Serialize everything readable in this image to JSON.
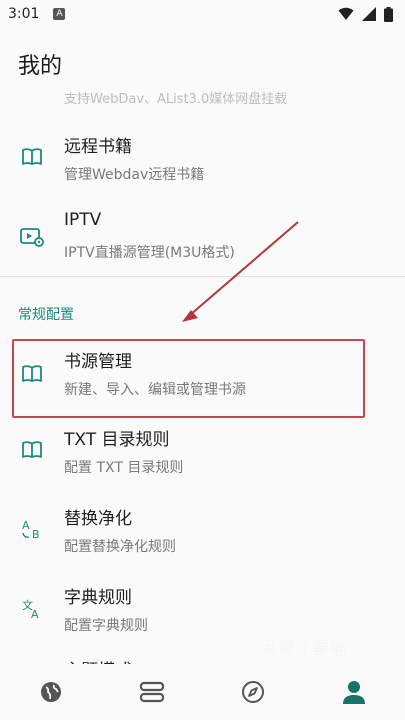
{
  "status_bar": {
    "time": "3:01",
    "app_badge": "A"
  },
  "header": {
    "title": "我的"
  },
  "list": {
    "cut_subtitle": "支持WebDav、AList3.0媒体网盘挂载",
    "items": [
      {
        "icon": "book-icon",
        "title": "远程书籍",
        "subtitle": "管理Webdav远程书籍"
      },
      {
        "icon": "tv-gear-icon",
        "title": "IPTV",
        "subtitle": "IPTV直播源管理(M3U格式)"
      }
    ]
  },
  "section": {
    "header": "常规配置",
    "items": [
      {
        "icon": "book-icon",
        "title": "书源管理",
        "subtitle": "新建、导入、编辑或管理书源"
      },
      {
        "icon": "book-icon",
        "title": "TXT 目录规则",
        "subtitle": "配置 TXT 目录规则"
      },
      {
        "icon": "replace-icon",
        "title": "替换净化",
        "subtitle": "配置替换净化规则"
      },
      {
        "icon": "translate-icon",
        "title": "字典规则",
        "subtitle": "配置字典规则"
      },
      {
        "icon": "theme-icon",
        "title": "主题模式",
        "subtitle": ""
      }
    ]
  },
  "watermark": "沃德下载站",
  "bottom_nav": [
    {
      "icon": "globe-icon"
    },
    {
      "icon": "shelf-icon"
    },
    {
      "icon": "compass-icon"
    },
    {
      "icon": "profile-icon",
      "active": true
    }
  ],
  "colors": {
    "accent": "#1a8a7e",
    "highlight": "#c8474f",
    "arrow": "#b3363b",
    "nav_active": "#16756a",
    "nav_inactive": "#555555"
  }
}
